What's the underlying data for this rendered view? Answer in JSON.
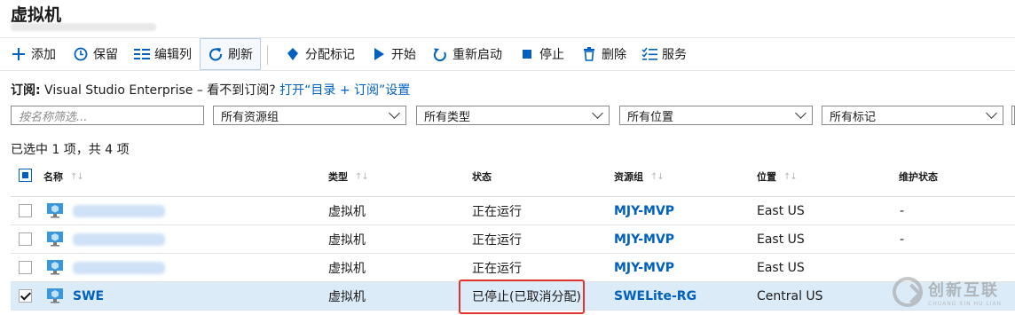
{
  "header": {
    "title": "虚拟机"
  },
  "toolbar": {
    "add": "添加",
    "save": "保留",
    "edit_columns": "编辑列",
    "refresh": "刷新",
    "assign_tags": "分配标记",
    "start": "开始",
    "restart": "重新启动",
    "stop": "停止",
    "delete": "删除",
    "services": "服务"
  },
  "subscription": {
    "label": "订阅:",
    "text": " Visual Studio Enterprise – 看不到订阅? ",
    "link": "打开“目录 + 订阅”设置"
  },
  "filters": {
    "name_placeholder": "按名称筛选...",
    "resource_group": "所有资源组",
    "type": "所有类型",
    "location": "所有位置",
    "tags": "所有标记"
  },
  "selection_count": "已选中 1 项，共 4 项",
  "columns": {
    "name": "名称",
    "type": "类型",
    "status": "状态",
    "resource_group": "资源组",
    "location": "位置",
    "maintenance": "维护状态"
  },
  "rows": [
    {
      "name": "",
      "type": "虚拟机",
      "status": "正在运行",
      "resource_group": "MJY-MVP",
      "location": "East US",
      "maintenance": "-",
      "checked": false
    },
    {
      "name": "",
      "type": "虚拟机",
      "status": "正在运行",
      "resource_group": "MJY-MVP",
      "location": "East US",
      "maintenance": "-",
      "checked": false
    },
    {
      "name": "",
      "type": "虚拟机",
      "status": "正在运行",
      "resource_group": "MJY-MVP",
      "location": "East US",
      "maintenance": "",
      "checked": false
    },
    {
      "name": "SWE",
      "type": "虚拟机",
      "status": "已停止(已取消分配)",
      "resource_group": "SWELite-RG",
      "location": "Central US",
      "maintenance": "",
      "checked": true
    }
  ],
  "watermark": {
    "main": "创新互联",
    "sub": "CHUANG XIN HU LIAN"
  },
  "colors": {
    "accent": "#0060c0",
    "selected_row": "#dcebf8",
    "highlight_border": "#e0322f"
  }
}
